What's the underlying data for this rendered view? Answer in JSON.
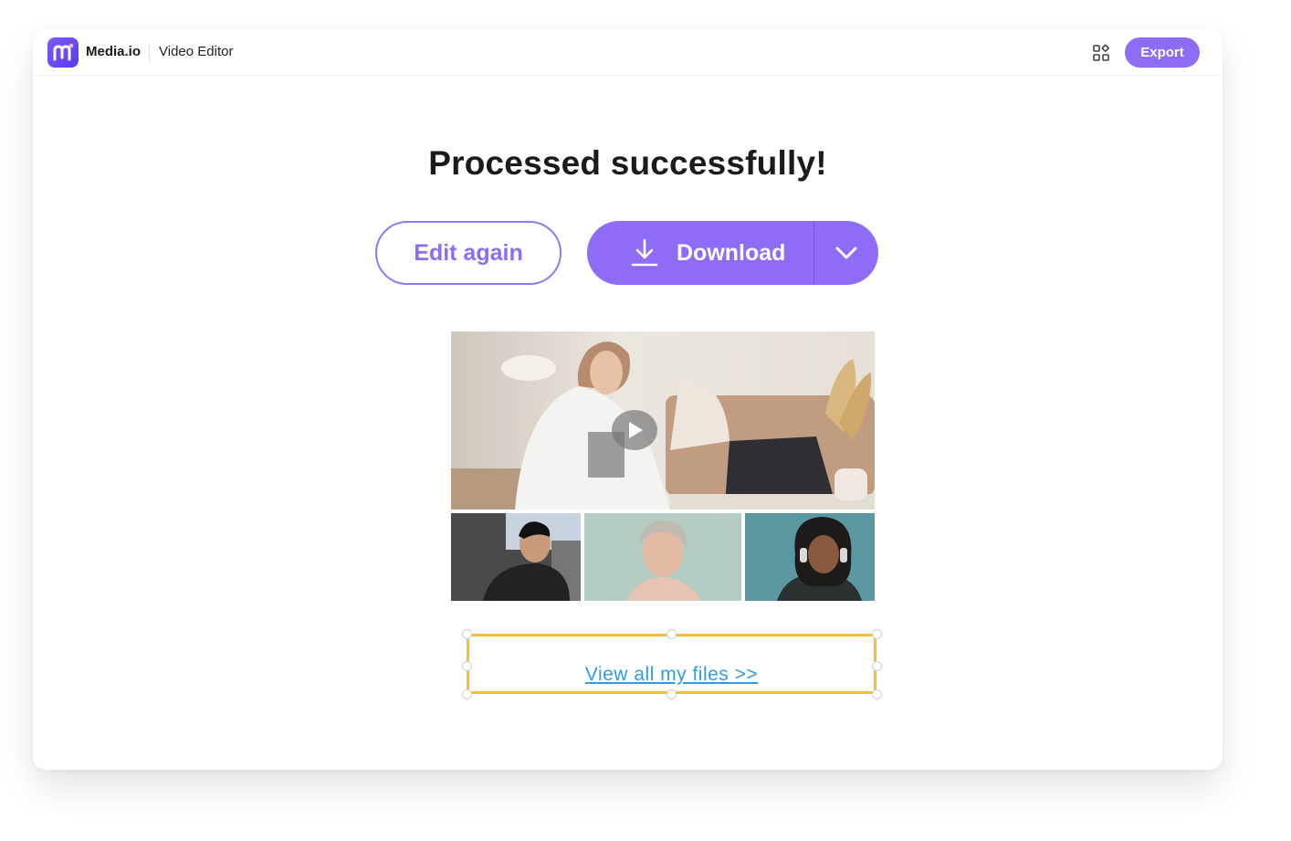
{
  "header": {
    "brand": "Media.io",
    "app_name": "Video Editor",
    "export_label": "Export"
  },
  "main": {
    "title": "Processed successfully!",
    "edit_again_label": "Edit again",
    "download_label": "Download",
    "view_all_label": "View all my files >>"
  },
  "colors": {
    "accent": "#8e6cf6",
    "link": "#2f9be8",
    "selection": "#f5bd3c"
  },
  "icons": [
    "media-io-logo-icon",
    "apps-grid-icon",
    "download-icon",
    "chevron-down-icon",
    "play-icon"
  ]
}
